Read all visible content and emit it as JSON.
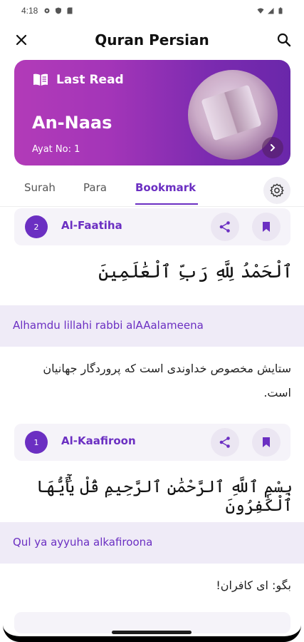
{
  "status_bar": {
    "time": "4:18"
  },
  "app_bar": {
    "title": "Quran Persian"
  },
  "last_read": {
    "label": "Last Read",
    "surah": "An-Naas",
    "ayat": "Ayat No: 1"
  },
  "tabs": [
    {
      "label": "Surah",
      "active": false
    },
    {
      "label": "Para",
      "active": false
    },
    {
      "label": "Bookmark",
      "active": true
    }
  ],
  "bookmarks": [
    {
      "number": "2",
      "surah": "Al-Faatiha",
      "arabic": "ٱلْحَمْدُ لِلَّهِ رَبِّ ٱلْعَٰلَمِينَ",
      "transliteration": "Alhamdu lillahi rabbi alAAalameena",
      "translation": "ستایش مخصوص خداوندی است که پروردگار جهانیان است."
    },
    {
      "number": "1",
      "surah": "Al-Kaafiroon",
      "arabic": "بِسْمِ ٱللَّهِ ٱلرَّحْمَٰنِ ٱلرَّحِيمِ قُلْ يَٰٓأَيُّهَا ٱلْكَٰفِرُونَ",
      "transliteration": "Qul ya ayyuha alkafiroona",
      "translation": "بگو: ای کافران!"
    }
  ],
  "colors": {
    "accent": "#6b2fc2",
    "card_start": "#b23bb8",
    "card_end": "#6a27aa",
    "band": "#efebf7"
  }
}
